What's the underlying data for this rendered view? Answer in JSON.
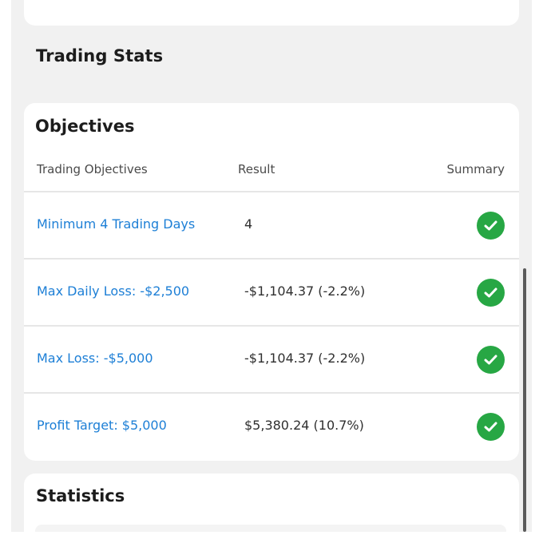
{
  "trading_stats": {
    "title": "Trading Stats"
  },
  "objectives": {
    "title": "Objectives",
    "columns": {
      "objective": "Trading Objectives",
      "result": "Result",
      "summary": "Summary"
    },
    "rows": [
      {
        "objective": "Minimum 4 Trading Days",
        "result": "4",
        "status_icon": "check-circle-icon",
        "passed": true
      },
      {
        "objective": "Max Daily Loss: -$2,500",
        "result": "-$1,104.37 (-2.2%)",
        "status_icon": "check-circle-icon",
        "passed": true
      },
      {
        "objective": "Max Loss: -$5,000",
        "result": "-$1,104.37 (-2.2%)",
        "status_icon": "check-circle-icon",
        "passed": true
      },
      {
        "objective": "Profit Target: $5,000",
        "result": "$5,380.24 (10.7%)",
        "status_icon": "check-circle-icon",
        "passed": true
      }
    ]
  },
  "statistics": {
    "title": "Statistics"
  },
  "colors": {
    "link": "#1d7fd6",
    "success": "#27a744",
    "panel_background": "#f1f1f1"
  }
}
